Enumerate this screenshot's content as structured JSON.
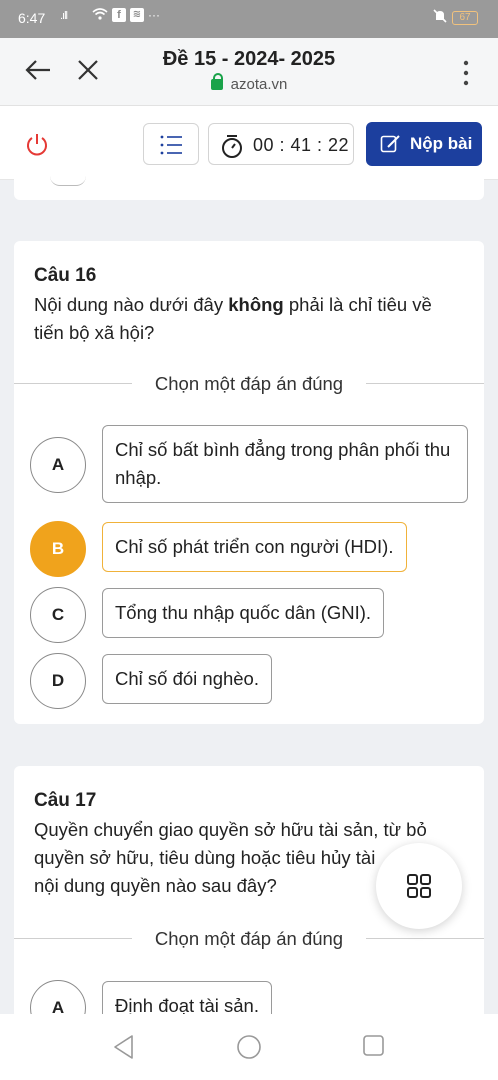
{
  "status_bar": {
    "time": "6:47",
    "signal": ".ıll",
    "fb_label": "f",
    "app2_label": "≋",
    "more": "···",
    "battery": "67"
  },
  "browser": {
    "title": "Đề 15 - 2024- 2025",
    "url": "azota.vn"
  },
  "toolbar": {
    "timer": "00 : 41 : 22",
    "submit_label": "Nộp bài",
    "submit_color": "#1c3f9e"
  },
  "questions": [
    {
      "number": "Câu 16",
      "text_before": "Nội dung nào dưới đây ",
      "text_bold": "không",
      "text_after": " phải là chỉ tiêu về tiến bộ xã hội?",
      "prompt": "Chọn một đáp án đúng",
      "options": [
        {
          "letter": "A",
          "text": "Chỉ số bất bình đẳng trong phân phối thu nhập.",
          "selected": false
        },
        {
          "letter": "B",
          "text": "Chỉ số phát triển con người (HDI).",
          "selected": true
        },
        {
          "letter": "C",
          "text": "Tổng thu nhập quốc dân (GNI).",
          "selected": false
        },
        {
          "letter": "D",
          "text": "Chỉ số đói nghèo.",
          "selected": false
        }
      ]
    },
    {
      "number": "Câu 17",
      "text": "Quyền chuyển giao quyền sở hữu tài sản, từ bỏ quyền sở hữu, tiêu dùng hoặc tiêu hủy tài sản là nội dung quyền nào sau đây?",
      "text_visible_line2": "quyền sở hữu, tiêu dùng hoặc tiêu hủy tài",
      "text_visible_line1": "Quyền chuyển giao quyền sở hữu tài sản, từ bỏ",
      "text_visible_line3": "nội dung quyền nào sau đây?",
      "prompt": "Chọn một đáp án đúng",
      "options": [
        {
          "letter": "A",
          "text": "Định đoạt tài sản.",
          "selected": false
        }
      ]
    }
  ],
  "colors": {
    "selected_option": "#f0a31c",
    "power_icon": "#e53935",
    "lock_icon": "#1aa34a"
  }
}
